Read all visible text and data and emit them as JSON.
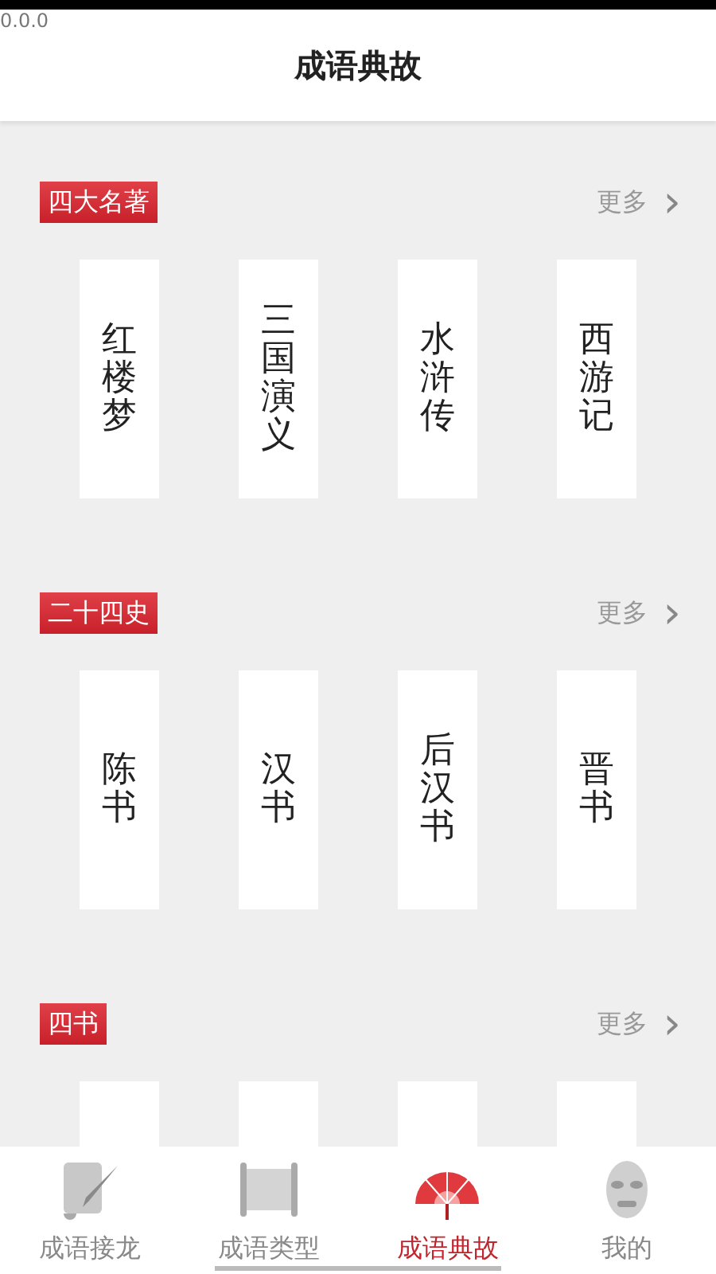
{
  "status_bar": {
    "text": "0.0.0"
  },
  "header": {
    "title": "成语典故"
  },
  "sections": [
    {
      "tag": "四大名著",
      "more": "更多",
      "more_icon": "›",
      "books": [
        {
          "kind": "book",
          "title": "红楼梦"
        },
        {
          "kind": "book",
          "title": "三国演义"
        },
        {
          "kind": "book",
          "title": "水浒传"
        },
        {
          "kind": "book",
          "title": "西游记"
        }
      ]
    },
    {
      "tag": "二十四史",
      "more": "更多",
      "more_icon": "›",
      "books": [
        {
          "kind": "book",
          "title": "陈书"
        },
        {
          "kind": "book",
          "title": "汉书"
        },
        {
          "kind": "book",
          "title": "后汉书"
        },
        {
          "kind": "book",
          "title": "晋书"
        }
      ]
    },
    {
      "tag": "四书",
      "more": "更多",
      "more_icon": "›",
      "books": [
        {
          "kind": "blank"
        },
        {
          "kind": "blank"
        },
        {
          "kind": "blank"
        },
        {
          "kind": "blank"
        }
      ]
    }
  ],
  "tabs": [
    {
      "label": "成语接龙",
      "kind": "brush",
      "selected": false
    },
    {
      "label": "成语类型",
      "kind": "scroll",
      "selected": false
    },
    {
      "label": "成语典故",
      "kind": "fan",
      "selected": true
    },
    {
      "label": "我的",
      "kind": "mask",
      "selected": false
    }
  ]
}
